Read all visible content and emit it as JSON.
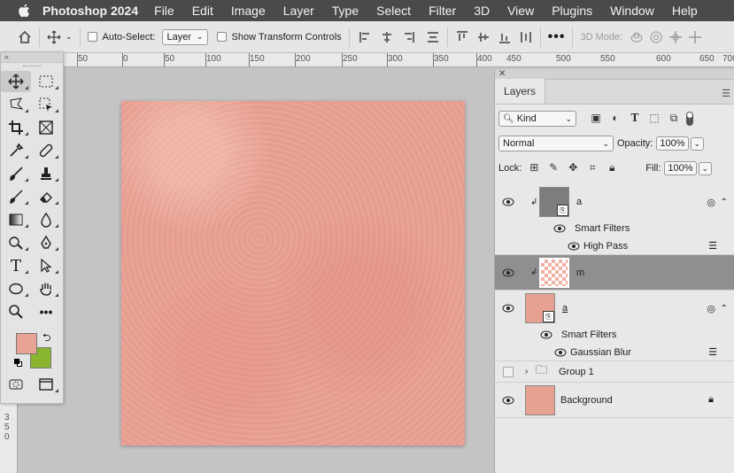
{
  "menubar": {
    "app_name": "Photoshop 2024",
    "items": [
      "File",
      "Edit",
      "Image",
      "Layer",
      "Type",
      "Select",
      "Filter",
      "3D",
      "View",
      "Plugins",
      "Window",
      "Help"
    ]
  },
  "options_bar": {
    "auto_select_label": "Auto-Select:",
    "auto_select_checked": false,
    "auto_select_target": "Layer",
    "show_transform_label": "Show Transform Controls",
    "show_transform_checked": false,
    "mode_3d_label": "3D Mode:"
  },
  "ruler": {
    "top_labels": [
      "50",
      "0",
      "50",
      "100",
      "150",
      "200",
      "250",
      "300",
      "350",
      "400",
      "450",
      "500",
      "550",
      "600",
      "650",
      "700"
    ],
    "left_labels": [
      "3",
      "5",
      "0"
    ]
  },
  "toolbar": {
    "foreground_color": "#e8a395",
    "background_color": "#8ab52e"
  },
  "layers_panel": {
    "tab_label": "Layers",
    "kind_filter": "Kind",
    "blend_mode": "Normal",
    "opacity_label": "Opacity:",
    "opacity_value": "100%",
    "lock_label": "Lock:",
    "fill_label": "Fill:",
    "fill_value": "100%",
    "layers": [
      {
        "name": "a",
        "smart_filters_label": "Smart Filters",
        "filter": "High Pass",
        "clipped": true,
        "visible": true,
        "selected": false
      },
      {
        "name": "m",
        "clipped": true,
        "visible": true,
        "selected": true
      },
      {
        "name": "a",
        "smart_filters_label": "Smart Filters",
        "filter": "Gaussian Blur",
        "clipped": false,
        "visible": true,
        "selected": false
      },
      {
        "name": "Group 1",
        "visible": false,
        "selected": false
      },
      {
        "name": "Background",
        "visible": true,
        "locked": true,
        "selected": false
      }
    ]
  }
}
